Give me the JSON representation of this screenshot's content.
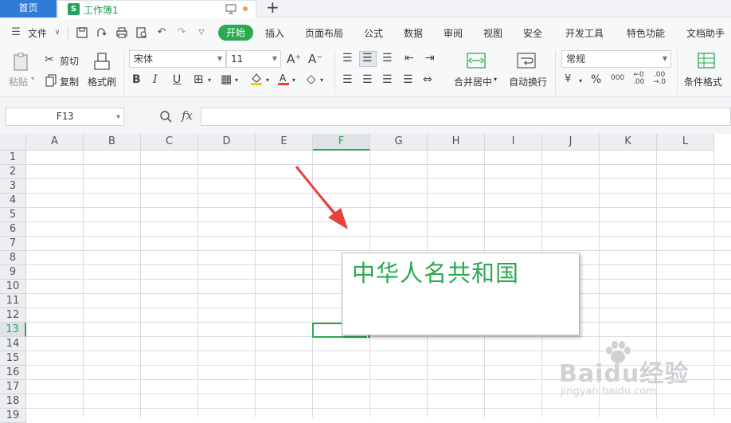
{
  "tabs": {
    "home": "首页",
    "doc_icon": "S",
    "doc": "工作簿1",
    "new_tab": "+"
  },
  "menu": {
    "file": "文件",
    "items": [
      "开始",
      "插入",
      "页面布局",
      "公式",
      "数据",
      "审阅",
      "视图",
      "安全",
      "开发工具",
      "特色功能",
      "文档助手"
    ]
  },
  "toolbar": {
    "paste": "粘贴",
    "cut": "剪切",
    "copy": "复制",
    "format_painter": "格式刷",
    "font_name": "宋体",
    "font_size": "11",
    "merge_center": "合并居中",
    "wrap_text": "自动换行",
    "number_format": "常规",
    "percent": "%",
    "thousands": "000",
    "conditional_format": "条件格式"
  },
  "formula_bar": {
    "cell_ref": "F13",
    "fx": "fx",
    "formula": ""
  },
  "grid": {
    "columns": [
      "A",
      "B",
      "C",
      "D",
      "E",
      "F",
      "G",
      "H",
      "I",
      "J",
      "K",
      "L"
    ],
    "rows": [
      "1",
      "2",
      "3",
      "4",
      "5",
      "6",
      "7",
      "8",
      "9",
      "10",
      "11",
      "12",
      "13",
      "14",
      "15",
      "16",
      "17",
      "18",
      "19"
    ],
    "selected_column": "F",
    "selected_row": "13"
  },
  "textbox": {
    "text": "中华人名共和国"
  },
  "colors": {
    "accent": "#2aaa50",
    "home_tab": "#2f7bd6",
    "arrow": "#e8403a"
  },
  "watermark": {
    "title": "Baidu经验",
    "url": "jingyan.baidu.com"
  }
}
